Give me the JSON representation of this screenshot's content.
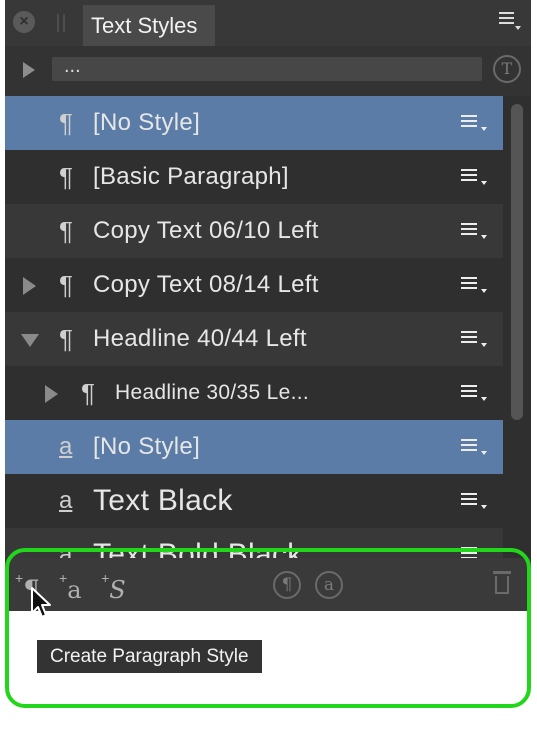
{
  "panel": {
    "tab_title": "Text Styles",
    "search_value": "...",
    "t_button": "T"
  },
  "rows": [
    {
      "symbol": "¶",
      "label": "[No Style]",
      "expander": "none",
      "selected": true
    },
    {
      "symbol": "¶",
      "label": "[Basic Paragraph]",
      "expander": "none",
      "selected": false
    },
    {
      "symbol": "¶",
      "label": "Copy Text 06/10 Left",
      "expander": "none",
      "selected": false
    },
    {
      "symbol": "¶",
      "label": "Copy Text 08/14 Left",
      "expander": "right",
      "selected": false
    },
    {
      "symbol": "¶",
      "label": "Headline 40/44 Left",
      "expander": "down",
      "selected": false
    },
    {
      "symbol": "¶",
      "label": "Headline 30/35 Le...",
      "expander": "right",
      "selected": false
    },
    {
      "symbol": "a",
      "label": "[No Style]",
      "expander": "none",
      "selected": true
    },
    {
      "symbol": "a",
      "label": "Text Black",
      "expander": "none",
      "selected": false
    },
    {
      "symbol": "a",
      "label": "Text Bold Black",
      "expander": "none",
      "selected": false
    }
  ],
  "toolbar": {
    "add_paragraph_symbol": "¶",
    "add_character_symbol": "a",
    "add_group_symbol": "S",
    "plus": "+",
    "paragraph_circle": "¶",
    "character_circle": "a"
  },
  "tooltip": "Create Paragraph Style",
  "colors": {
    "selection": "#5a7ca6",
    "highlight_border": "#22d61c",
    "panel_bg": "#2f2f2f"
  },
  "icons": [
    "close-icon",
    "grip-icon",
    "panel-menu-icon",
    "expand-triangle-icon",
    "text-tool-icon",
    "row-menu-icon",
    "trash-icon",
    "mouse-pointer-icon"
  ]
}
